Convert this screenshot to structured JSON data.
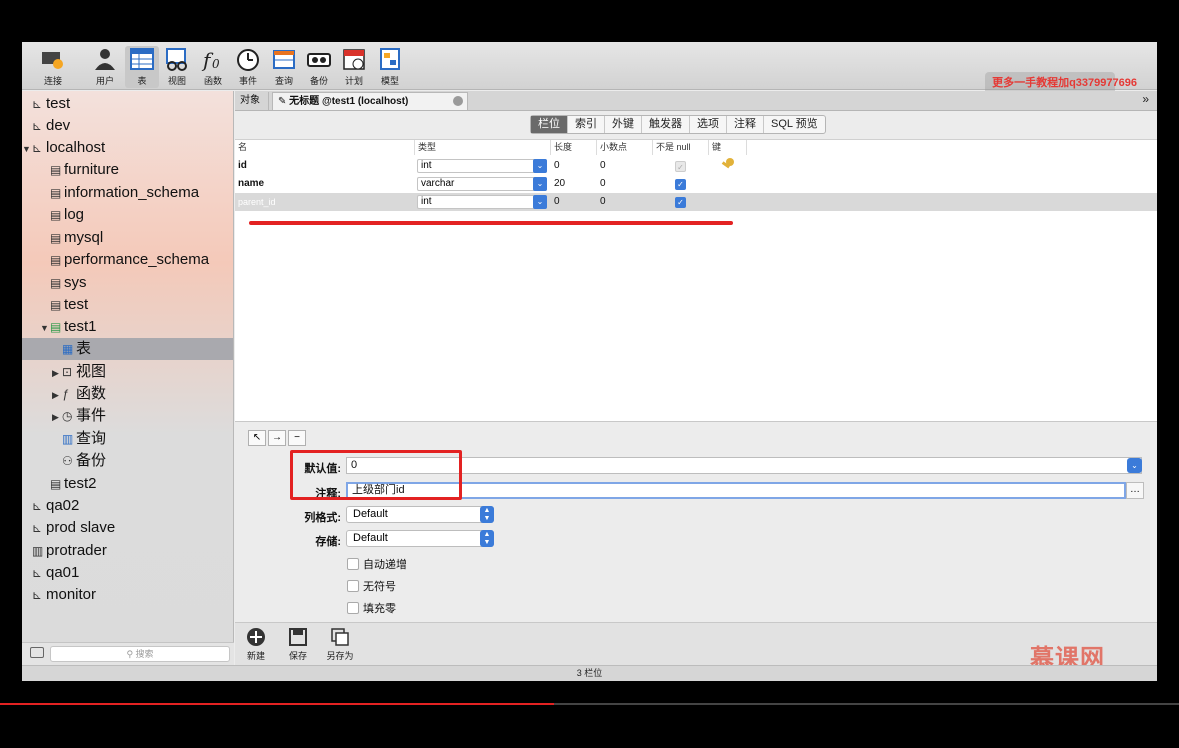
{
  "toolbar": {
    "items": [
      {
        "label": "连接",
        "icon": "connection-icon"
      },
      {
        "label": "用户",
        "icon": "user-icon"
      },
      {
        "label": "表",
        "icon": "table-icon"
      },
      {
        "label": "视图",
        "icon": "view-icon"
      },
      {
        "label": "函数",
        "icon": "function-icon"
      },
      {
        "label": "事件",
        "icon": "event-icon"
      },
      {
        "label": "查询",
        "icon": "query-icon"
      },
      {
        "label": "备份",
        "icon": "backup-icon"
      },
      {
        "label": "计划",
        "icon": "schedule-icon"
      },
      {
        "label": "模型",
        "icon": "model-icon"
      }
    ],
    "watermark": "更多一手教程加q3379977696"
  },
  "sidebar": {
    "items": [
      {
        "label": "test"
      },
      {
        "label": "dev"
      },
      {
        "label": "localhost"
      },
      {
        "label": "furniture"
      },
      {
        "label": "information_schema"
      },
      {
        "label": "log"
      },
      {
        "label": "mysql"
      },
      {
        "label": "performance_schema"
      },
      {
        "label": "sys"
      },
      {
        "label": "test"
      },
      {
        "label": "test1"
      },
      {
        "label": "表"
      },
      {
        "label": "视图"
      },
      {
        "label": "函数"
      },
      {
        "label": "事件"
      },
      {
        "label": "查询"
      },
      {
        "label": "备份"
      },
      {
        "label": "test2"
      },
      {
        "label": "qa02"
      },
      {
        "label": "prod slave"
      },
      {
        "label": "protrader"
      },
      {
        "label": "qa01"
      },
      {
        "label": "monitor"
      }
    ],
    "search_placeholder": "搜索"
  },
  "tabs": {
    "objects": "对象",
    "document": "无标题 @test1 (localhost)"
  },
  "segments": [
    "栏位",
    "索引",
    "外键",
    "触发器",
    "选项",
    "注释",
    "SQL 预览"
  ],
  "grid": {
    "headers": [
      "名",
      "类型",
      "长度",
      "小数点",
      "不是 null",
      "键"
    ],
    "rows": [
      {
        "name": "id",
        "type": "int",
        "length": "0",
        "decimals": "0",
        "not_null": true,
        "key": true
      },
      {
        "name": "name",
        "type": "varchar",
        "length": "20",
        "decimals": "0",
        "not_null": true,
        "key": false
      },
      {
        "name": "parent_id",
        "type": "int",
        "length": "0",
        "decimals": "0",
        "not_null": true,
        "key": false
      }
    ]
  },
  "props": {
    "default_label": "默认值:",
    "default_value": "0",
    "comment_label": "注释:",
    "comment_value": "上级部门id",
    "format_label": "列格式:",
    "format_value": "Default",
    "storage_label": "存储:",
    "storage_value": "Default",
    "auto_increment": "自动递增",
    "unsigned": "无符号",
    "zerofill": "填充零"
  },
  "bottom": {
    "new": "新建",
    "save": "保存",
    "save_as": "另存为"
  },
  "status": "3 栏位",
  "brand": "慕课网",
  "accent": "#3b7bd9",
  "highlight": "#e32222",
  "video_progress": 0.47
}
